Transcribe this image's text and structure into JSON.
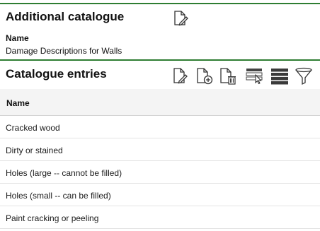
{
  "additional_catalogue": {
    "title": "Additional catalogue",
    "edit_icon": "document-edit-icon",
    "name_label": "Name",
    "name_value": "Damage Descriptions for Walls"
  },
  "catalogue_entries": {
    "title": "Catalogue entries",
    "toolbar_icons": [
      "document-edit-icon",
      "document-add-icon",
      "document-delete-icon",
      "row-select-icon",
      "list-view-icon",
      "filter-icon"
    ],
    "column_header": "Name",
    "rows": [
      "Cracked wood",
      "Dirty or stained",
      "Holes (large -- cannot be filled)",
      "Holes (small -- can be filled)",
      "Paint cracking or peeling"
    ]
  },
  "colors": {
    "accent": "#2e7d32",
    "header_bg": "#f4f4f4",
    "icon_dark": "#3a3a3a"
  }
}
